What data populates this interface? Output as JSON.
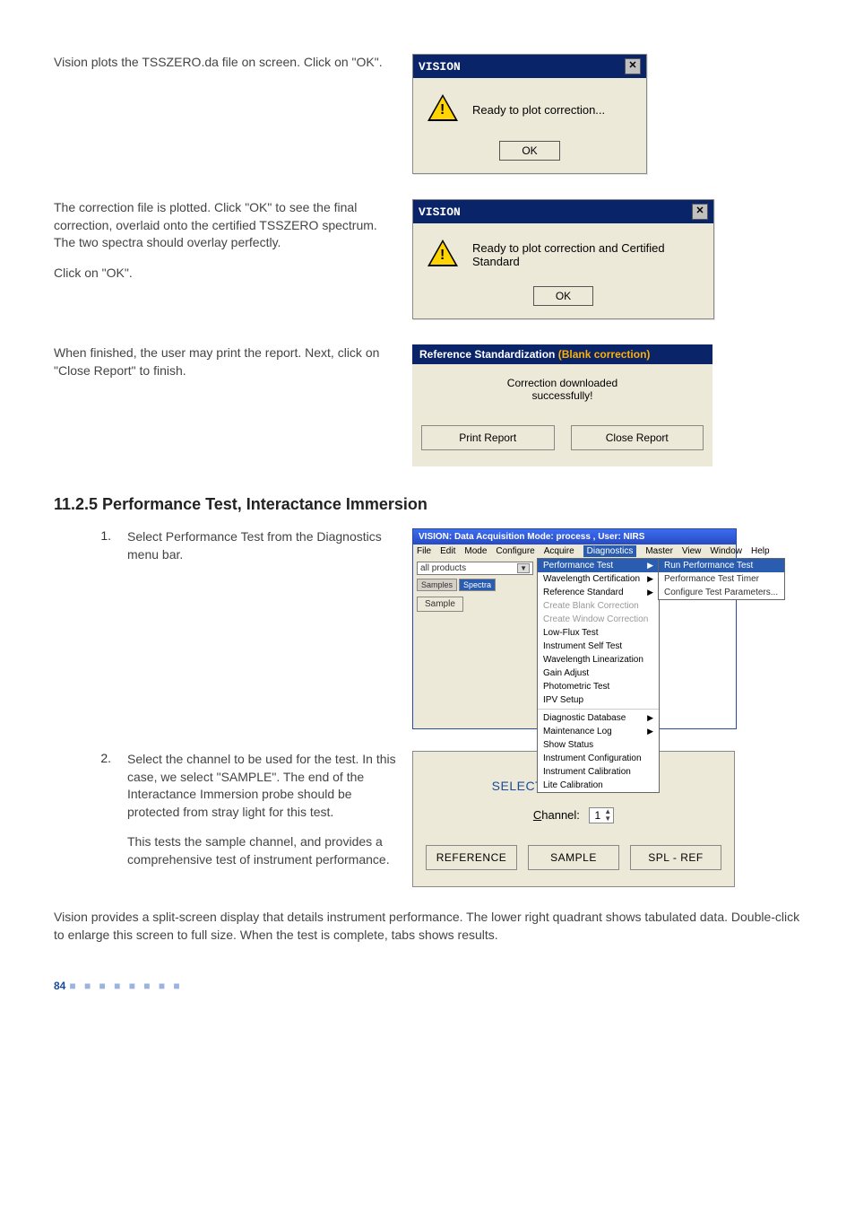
{
  "block1": {
    "text": "Vision plots the TSSZERO.da file on screen. Click on \"OK\".",
    "dialog": {
      "title": "VISION",
      "message": "Ready to plot correction...",
      "ok": "OK"
    }
  },
  "block2": {
    "text1": "The correction file is plotted. Click \"OK\" to see the final correction, overlaid onto the certified TSSZERO spectrum. The two spectra should overlay perfectly.",
    "text2": "Click on \"OK\".",
    "dialog": {
      "title": "VISION",
      "message": "Ready to plot correction and Certified Standard",
      "ok": "OK"
    }
  },
  "block3": {
    "text": "When finished, the user may print the report. Next, click on \"Close Report\" to finish.",
    "panel": {
      "title_prefix": "Reference Standardization ",
      "title_orange": "(Blank correction)",
      "msg1": "Correction downloaded",
      "msg2": "successfully!",
      "btn_print": "Print Report",
      "btn_close": "Close Report"
    }
  },
  "section_heading": "11.2.5   Performance Test, Interactance Immersion",
  "step1": {
    "num": "1.",
    "text": "Select Performance Test from the Diagnostics menu bar.",
    "app": {
      "title": "VISION: Data Acquisition Mode: process , User: NIRS",
      "menubar": [
        "File",
        "Edit",
        "Mode",
        "Configure",
        "Acquire",
        "Diagnostics",
        "Master",
        "View",
        "Window",
        "Help"
      ],
      "combo": "all products",
      "tab_samples": "Samples",
      "tab_spectra": "Spectra",
      "sample_btn": "Sample",
      "menu": [
        {
          "l": "Performance Test",
          "hl": true,
          "sub": true
        },
        {
          "l": "Wavelength Certification",
          "sub": true
        },
        {
          "l": "Reference Standard",
          "sub": true
        },
        {
          "l": "Create Blank Correction",
          "dis": true
        },
        {
          "l": "Create Window Correction",
          "dis": true
        },
        {
          "l": "Low-Flux Test"
        },
        {
          "l": "Instrument Self Test"
        },
        {
          "l": "Wavelength Linearization"
        },
        {
          "l": "Gain Adjust"
        },
        {
          "l": "Photometric Test"
        },
        {
          "l": "IPV Setup"
        },
        {
          "l": "---"
        },
        {
          "l": "Diagnostic Database",
          "sub": true
        },
        {
          "l": "Maintenance Log",
          "sub": true
        },
        {
          "l": "Show Status"
        },
        {
          "l": "Instrument Configuration"
        },
        {
          "l": "Instrument Calibration"
        },
        {
          "l": "Lite Calibration"
        }
      ],
      "submenu": [
        "Run Performance Test",
        "Performance Test Timer",
        "Configure Test Parameters..."
      ]
    }
  },
  "step2": {
    "num": "2.",
    "text1": "Select the channel to be used for the test. In this case, we select \"SAMPLE\". The end of the Interactance Immersion probe should be protected from stray light for this test.",
    "text2": "This tests the sample channel, and provides a comprehensive test of instrument performance.",
    "fiber": {
      "title": "SELECT FIBER FOR TEST",
      "channel_prefix": "C",
      "channel_rest": "hannel:",
      "value": "1",
      "btn_ref": "REFERENCE",
      "btn_sample": "SAMPLE",
      "btn_splref": "SPL - REF"
    }
  },
  "bottom_para": "Vision provides a split-screen display that details instrument performance. The lower right quadrant shows tabulated data. Double-click to enlarge this screen to full size. When the test is complete, tabs shows results.",
  "page_number": "84"
}
